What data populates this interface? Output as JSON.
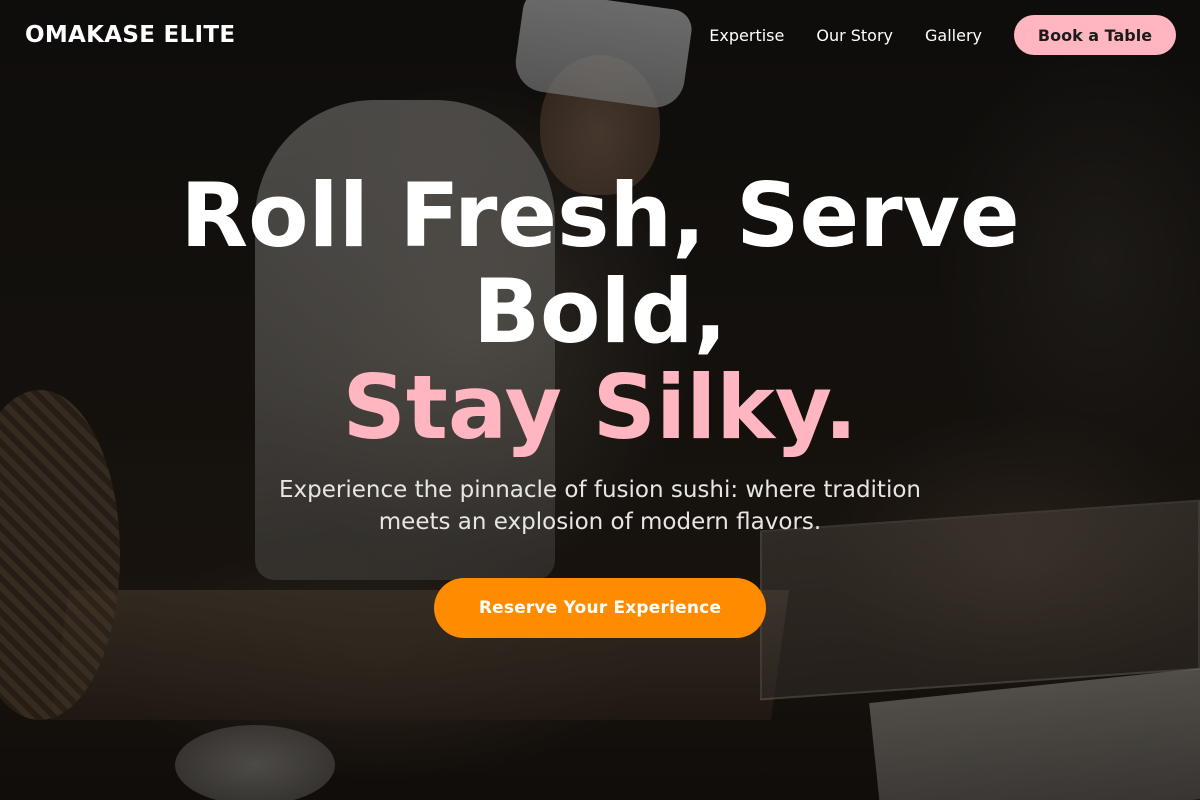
{
  "brand": {
    "name": "OMAKASE ELITE"
  },
  "nav": {
    "links": [
      {
        "label": "Expertise"
      },
      {
        "label": "Our Story"
      },
      {
        "label": "Gallery"
      }
    ],
    "cta_label": "Book a Table"
  },
  "hero": {
    "headline_line1": "Roll Fresh, Serve",
    "headline_line2": "Bold,",
    "headline_accent": "Stay Silky.",
    "subtitle": "Experience the pinnacle of fusion sushi: where tradition meets an explosion of modern flavors.",
    "cta_label": "Reserve Your Experience"
  },
  "colors": {
    "accent_pink": "#ffb6c1",
    "accent_orange": "#ff8c00",
    "text_primary": "#ffffff"
  }
}
